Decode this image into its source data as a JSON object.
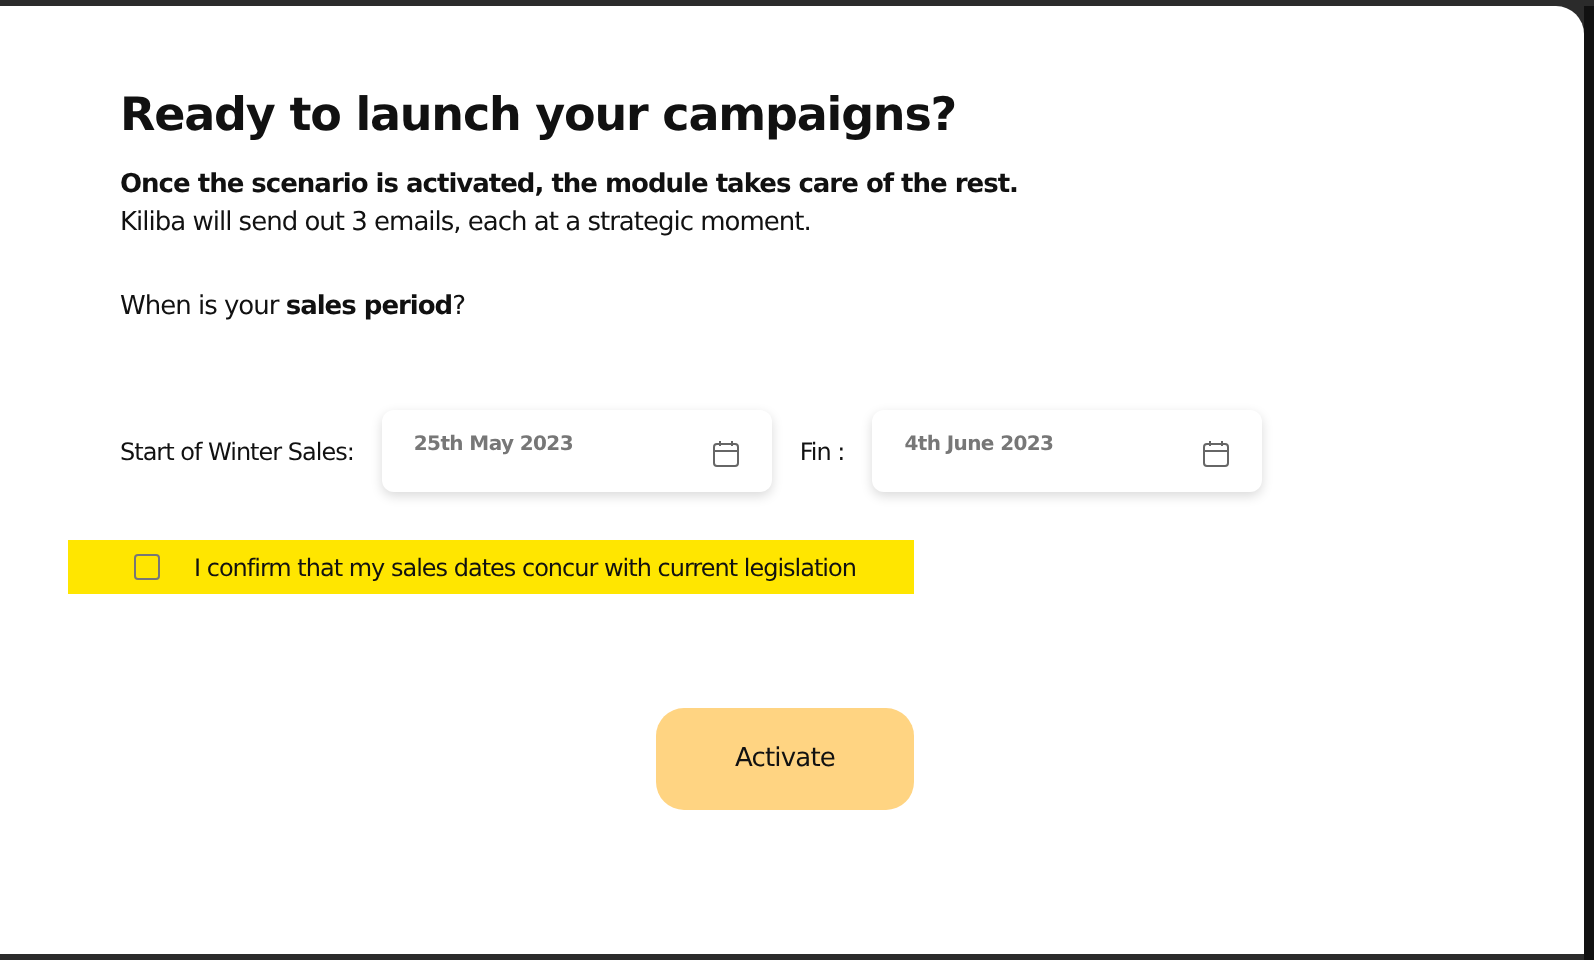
{
  "dialog": {
    "title": "Ready to launch your campaigns?",
    "intro": [
      "Once the scenario is activated, the module takes care of the rest.",
      "Kiliba will send out 3 emails, each at a strategic moment."
    ],
    "question": "When is your **sales period**?",
    "date_fields": [
      {
        "label": "Start of Winter Sales:",
        "value": "25th May 2023"
      },
      {
        "label": "Fin :",
        "value": "4th June 2023"
      }
    ],
    "confirmation": {
      "label": "I confirm that my sales dates concur with current legislation",
      "checked": false
    },
    "button": "Activate"
  }
}
